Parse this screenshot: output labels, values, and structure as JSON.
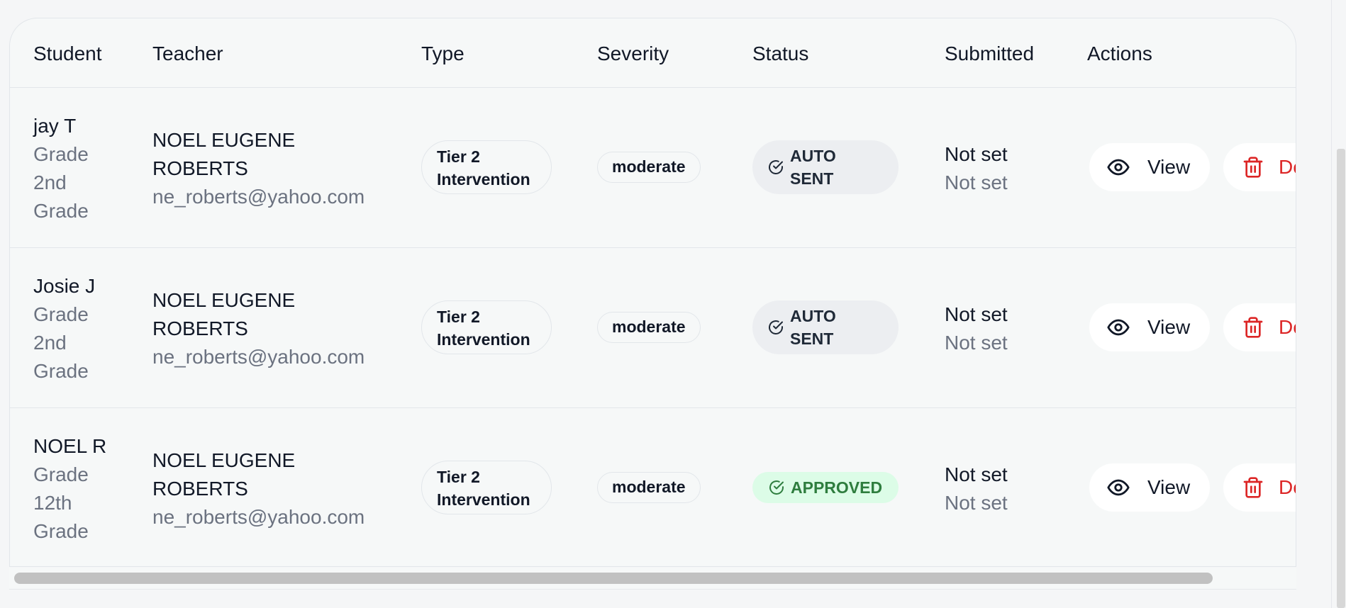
{
  "table": {
    "headers": {
      "student": "Student",
      "teacher": "Teacher",
      "type": "Type",
      "severity": "Severity",
      "status": "Status",
      "submitted": "Submitted",
      "actions": "Actions"
    },
    "rows": [
      {
        "student_name": "jay T",
        "grade_line1": "Grade",
        "grade_line2": "2nd",
        "grade_line3": "Grade",
        "teacher_name": "NOEL EUGENE ROBERTS",
        "teacher_email": "ne_roberts@yahoo.com",
        "type": "Tier 2 Intervention",
        "severity": "moderate",
        "status": "AUTO SENT",
        "submitted_main": "Not set",
        "submitted_sub": "Not set",
        "view_label": "View",
        "delete_label": "Delete"
      },
      {
        "student_name": "Josie J",
        "grade_line1": "Grade",
        "grade_line2": "2nd",
        "grade_line3": "Grade",
        "teacher_name": "NOEL EUGENE ROBERTS",
        "teacher_email": "ne_roberts@yahoo.com",
        "type": "Tier 2 Intervention",
        "severity": "moderate",
        "status": "AUTO SENT",
        "submitted_main": "Not set",
        "submitted_sub": "Not set",
        "view_label": "View",
        "delete_label": "Delete"
      },
      {
        "student_name": "NOEL R",
        "grade_line1": "Grade",
        "grade_line2": "12th",
        "grade_line3": "Grade",
        "teacher_name": "NOEL EUGENE ROBERTS",
        "teacher_email": "ne_roberts@yahoo.com",
        "type": "Tier 2 Intervention",
        "severity": "moderate",
        "status": "APPROVED",
        "submitted_main": "Not set",
        "submitted_sub": "Not set",
        "view_label": "View",
        "delete_label": "Delete"
      }
    ]
  },
  "icons": {
    "view": "eye-icon",
    "delete": "trash-icon",
    "status": "check-circle-icon"
  },
  "colors": {
    "delete": "#dc2626",
    "approved_bg": "#dcfce7",
    "approved_text": "#2e7d3e",
    "auto_sent_bg": "#eceef1"
  }
}
